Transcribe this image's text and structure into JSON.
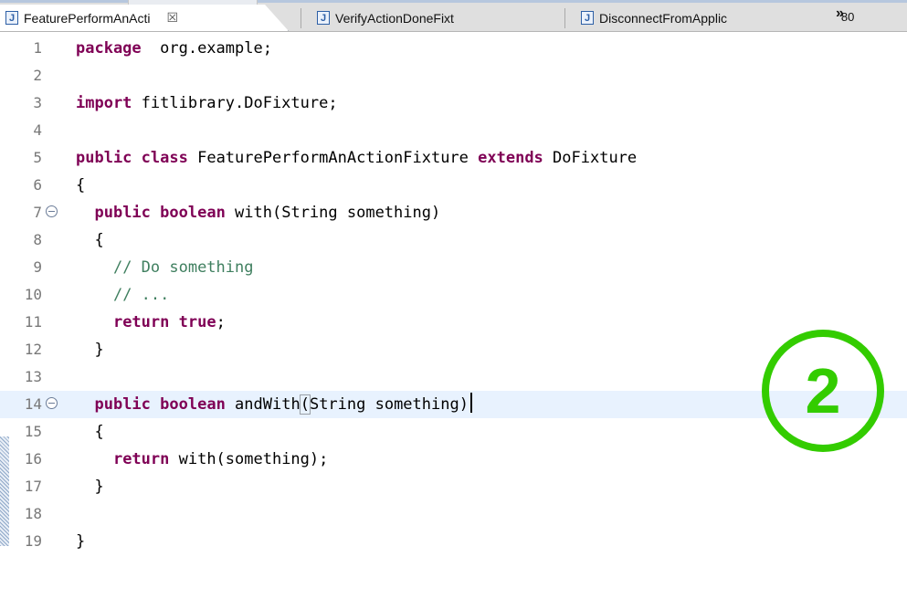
{
  "tabs": [
    {
      "label": "FeaturePerformAnActi",
      "close": "☒",
      "active": true
    },
    {
      "label": "VerifyActionDoneFixt",
      "active": false
    },
    {
      "label": "DisconnectFromApplic",
      "active": false
    }
  ],
  "tab_overflow": {
    "glyph": "»",
    "count": "80"
  },
  "icons": {
    "java_file": "J"
  },
  "colors": {
    "keyword": "#7f0055",
    "comment": "#3f7f5f",
    "current_line": "#e8f2fe",
    "annotation": "#33cc00"
  },
  "code_lines": [
    {
      "n": "1",
      "parts": [
        [
          "kw",
          "package"
        ],
        [
          "",
          "  org.example;"
        ]
      ]
    },
    {
      "n": "2",
      "parts": []
    },
    {
      "n": "3",
      "parts": [
        [
          "kw",
          "import"
        ],
        [
          "",
          " fitlibrary.DoFixture;"
        ]
      ]
    },
    {
      "n": "4",
      "parts": []
    },
    {
      "n": "5",
      "parts": [
        [
          "kw",
          "public"
        ],
        [
          "",
          " "
        ],
        [
          "kw",
          "class"
        ],
        [
          "",
          " FeaturePerformAnActionFixture "
        ],
        [
          "kw",
          "extends"
        ],
        [
          "",
          " DoFixture"
        ]
      ]
    },
    {
      "n": "6",
      "parts": [
        [
          "",
          "{"
        ]
      ]
    },
    {
      "n": "7",
      "fold": true,
      "parts": [
        [
          "",
          "  "
        ],
        [
          "kw",
          "public"
        ],
        [
          "",
          " "
        ],
        [
          "kw",
          "boolean"
        ],
        [
          "",
          " with(String something)"
        ]
      ]
    },
    {
      "n": "8",
      "parts": [
        [
          "",
          "  {"
        ]
      ]
    },
    {
      "n": "9",
      "parts": [
        [
          "",
          "    "
        ],
        [
          "cm",
          "// Do something"
        ]
      ]
    },
    {
      "n": "10",
      "parts": [
        [
          "",
          "    "
        ],
        [
          "cm",
          "// ..."
        ]
      ]
    },
    {
      "n": "11",
      "parts": [
        [
          "",
          "    "
        ],
        [
          "kw",
          "return"
        ],
        [
          "",
          " "
        ],
        [
          "kw",
          "true"
        ],
        [
          "",
          ";"
        ]
      ]
    },
    {
      "n": "12",
      "parts": [
        [
          "",
          "  }"
        ]
      ]
    },
    {
      "n": "13",
      "parts": []
    },
    {
      "n": "14",
      "fold": true,
      "current": true,
      "parts": [
        [
          "",
          "  "
        ],
        [
          "kw",
          "public"
        ],
        [
          "",
          " "
        ],
        [
          "kw",
          "boolean"
        ],
        [
          "",
          " andWith"
        ],
        [
          "box",
          "("
        ],
        [
          "",
          "String something)"
        ],
        [
          "caret",
          ""
        ]
      ]
    },
    {
      "n": "15",
      "parts": [
        [
          "",
          "  {"
        ]
      ]
    },
    {
      "n": "16",
      "parts": [
        [
          "",
          "    "
        ],
        [
          "kw",
          "return"
        ],
        [
          "",
          " with(something);"
        ]
      ]
    },
    {
      "n": "17",
      "parts": [
        [
          "",
          "  }"
        ]
      ]
    },
    {
      "n": "18",
      "parts": []
    },
    {
      "n": "19",
      "parts": [
        [
          "",
          "}"
        ]
      ]
    }
  ],
  "annotation": {
    "label": "2"
  }
}
